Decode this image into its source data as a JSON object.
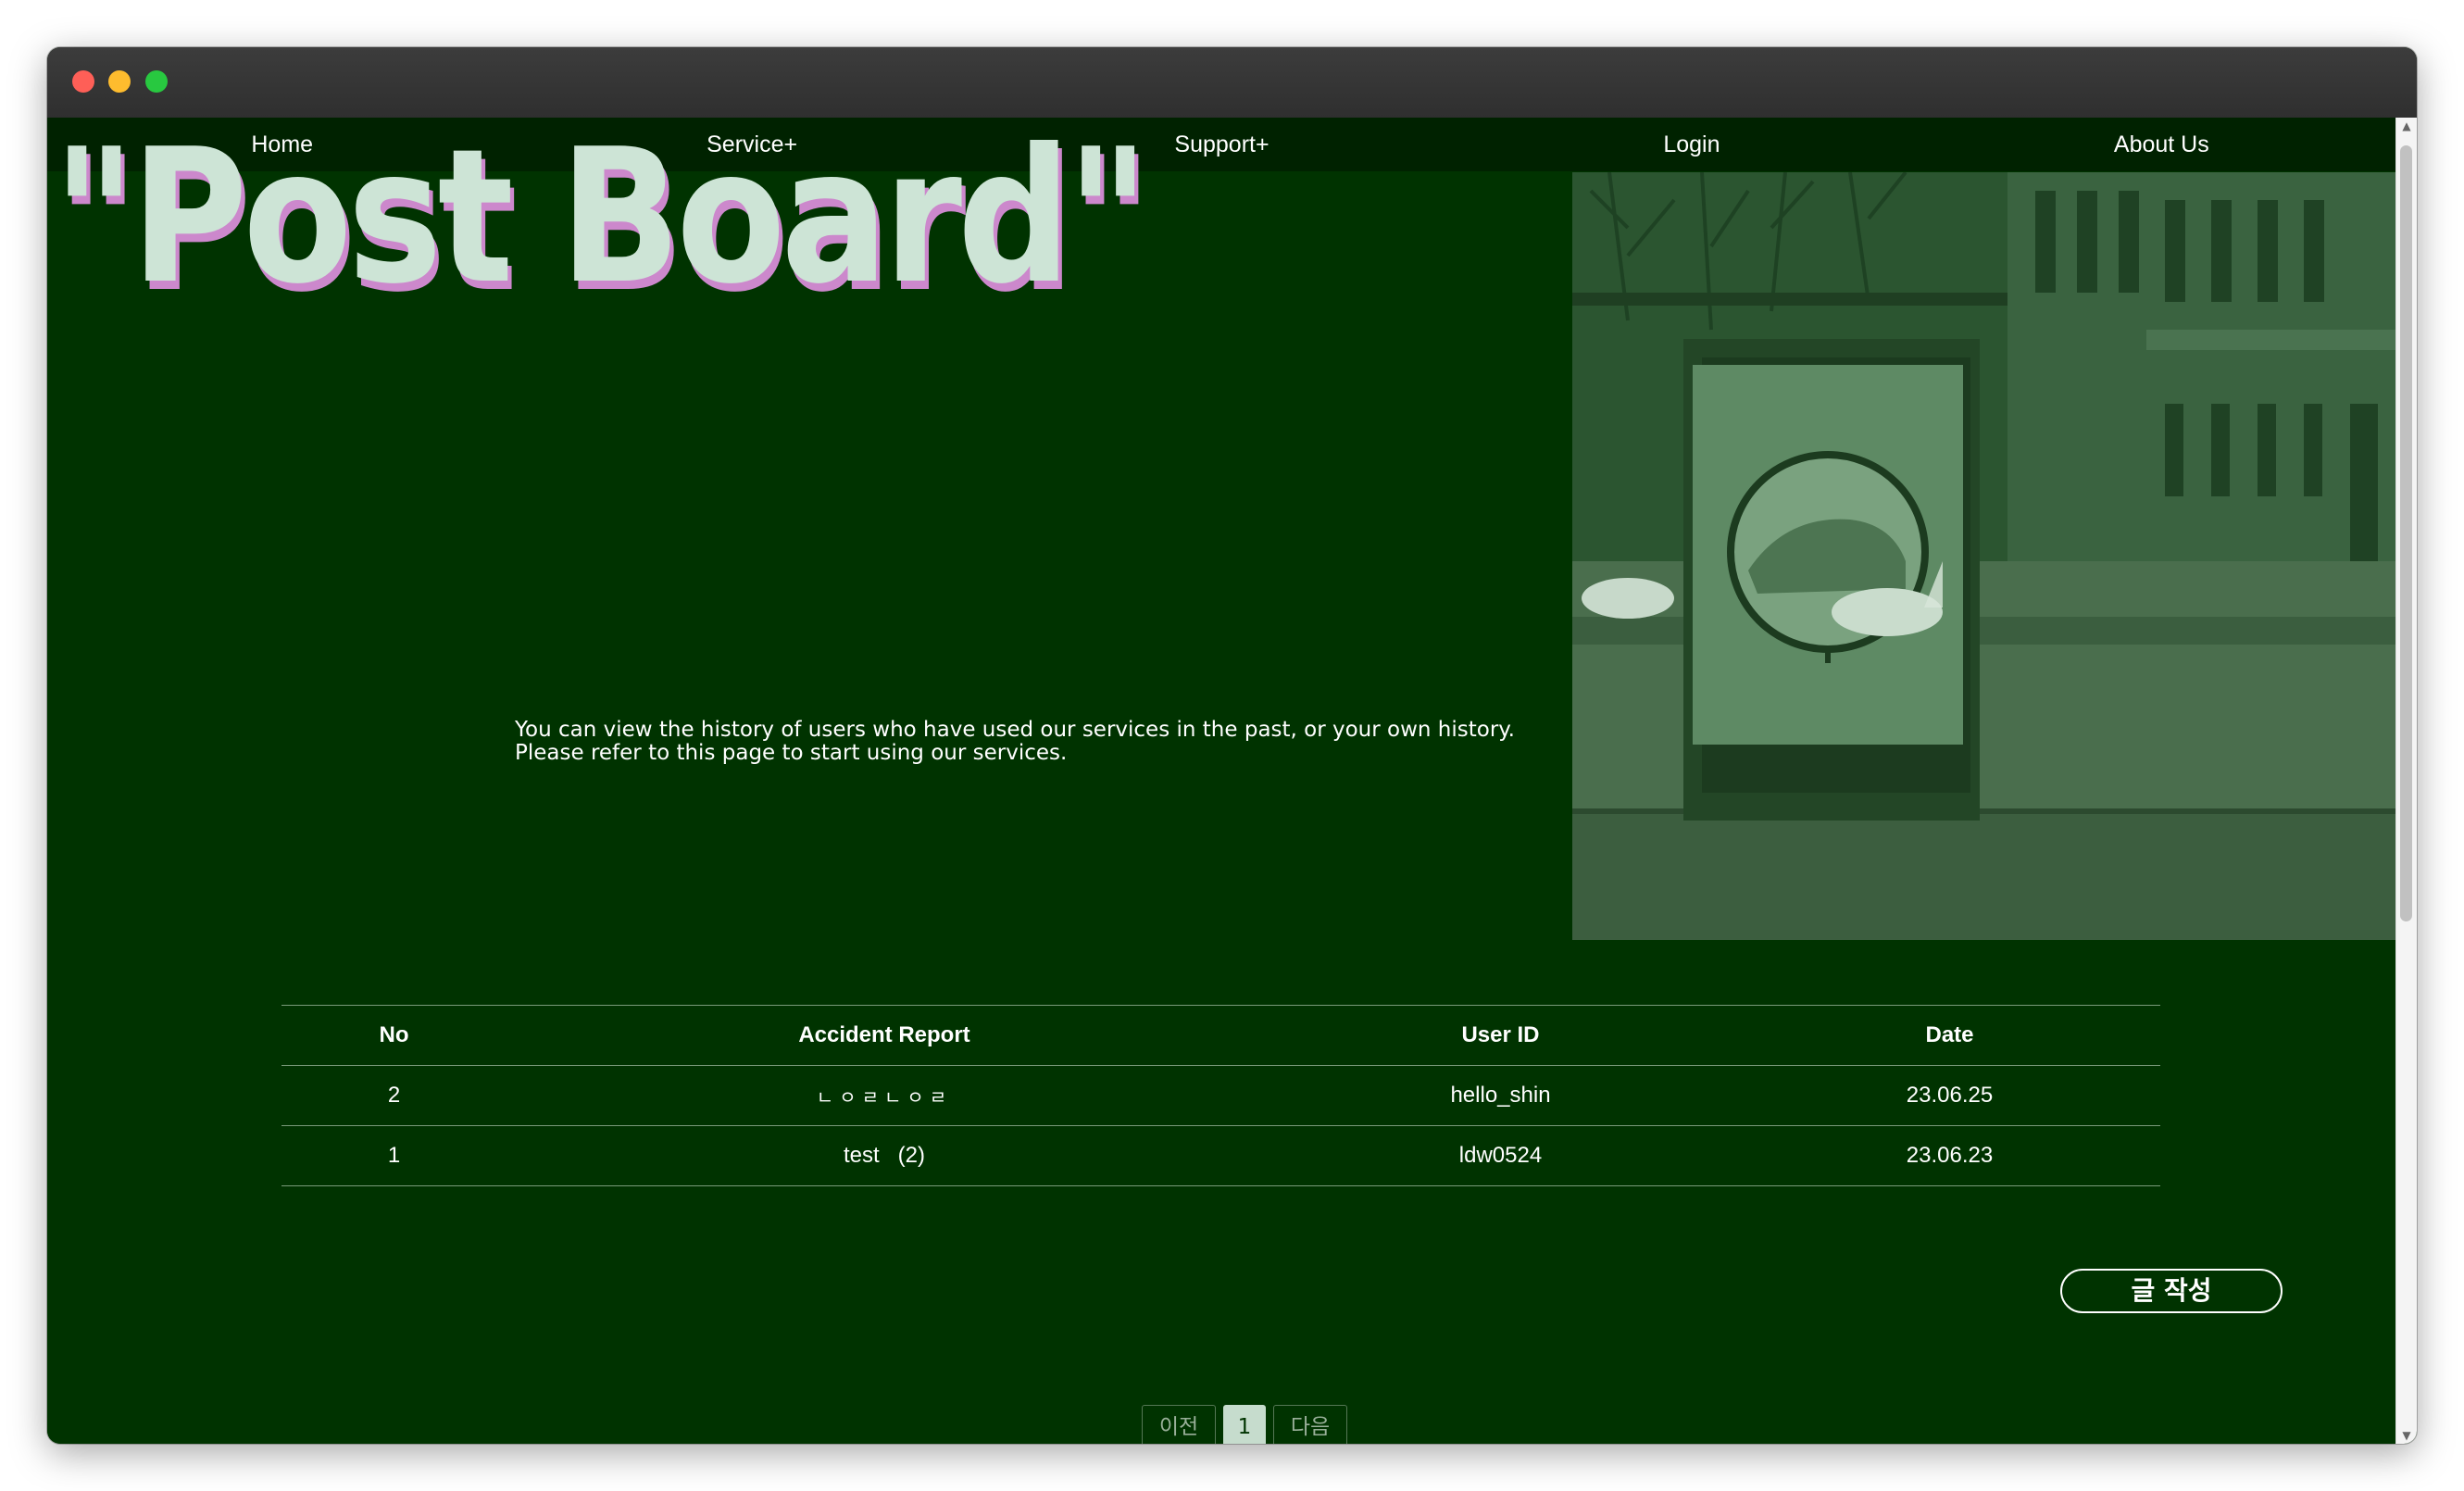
{
  "nav": {
    "items": [
      "Home",
      "Service+",
      "Support+",
      "Login",
      "About Us"
    ]
  },
  "hero": {
    "title": "\"Post Board\"",
    "intro_line1": "You can view the history of users who have used our services in the past, or your own history.",
    "intro_line2": "Please refer to this page to start using our services."
  },
  "table": {
    "headers": [
      "No",
      "Accident Report",
      "User ID",
      "Date"
    ],
    "rows": [
      {
        "no": "2",
        "title": "ㄴㅇㄹㄴㅇㄹ",
        "user": "hello_shin",
        "date": "23.06.25"
      },
      {
        "no": "1",
        "title": "test   (2)",
        "user": "ldw0524",
        "date": "23.06.23"
      }
    ]
  },
  "actions": {
    "write_label": "글 작성"
  },
  "pagination": {
    "prev": "이전",
    "current": "1",
    "next": "다음"
  },
  "colors": {
    "page_bg": "#003300",
    "nav_bg": "#002200",
    "title_fill": "#cde4d6",
    "title_shadow": "#cc88cc"
  }
}
